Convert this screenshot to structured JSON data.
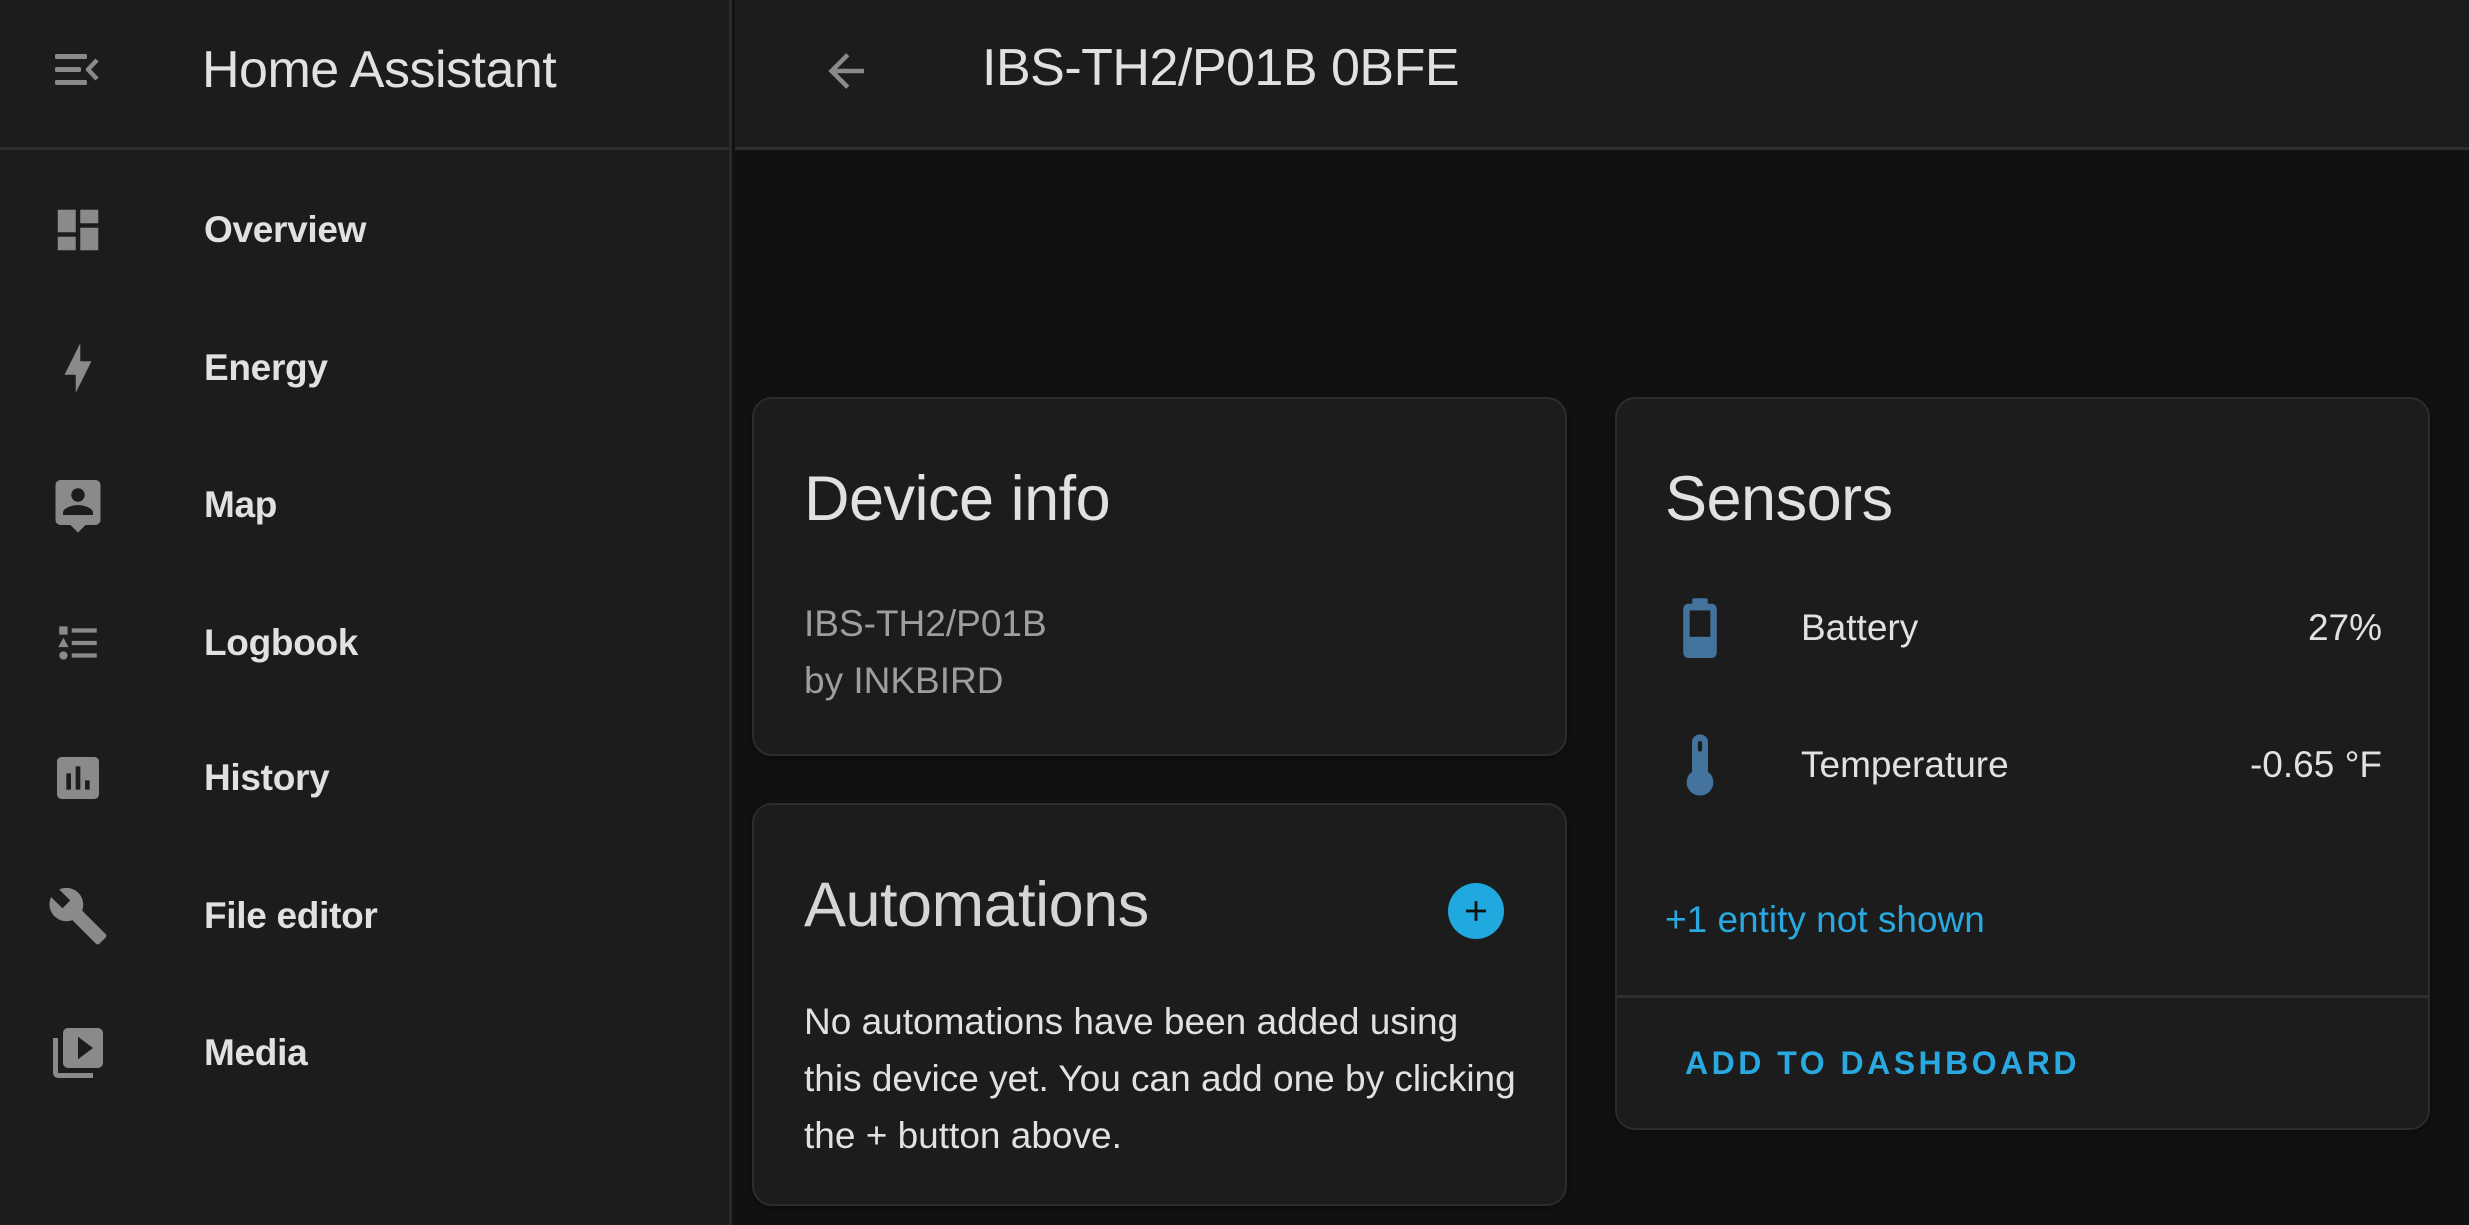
{
  "sidebar": {
    "title": "Home Assistant",
    "menu_icon": "menu-collapse-icon",
    "items": [
      {
        "label": "Overview",
        "icon": "view-dashboard-icon"
      },
      {
        "label": "Energy",
        "icon": "lightning-bolt-icon"
      },
      {
        "label": "Map",
        "icon": "account-location-icon"
      },
      {
        "label": "Logbook",
        "icon": "format-list-bulleted-type-icon"
      },
      {
        "label": "History",
        "icon": "chart-box-icon"
      },
      {
        "label": "File editor",
        "icon": "wrench-icon"
      },
      {
        "label": "Media",
        "icon": "play-box-multiple-icon"
      }
    ]
  },
  "header": {
    "back_icon": "arrow-left-icon",
    "title": "IBS-TH2/P01B 0BFE"
  },
  "device_info": {
    "title": "Device info",
    "model": "IBS-TH2/P01B",
    "manufacturer": "by INKBIRD"
  },
  "automations": {
    "title": "Automations",
    "add_icon": "plus-circle-icon",
    "empty_text": "No automations have been added using this device yet. You can add one by clicking the + button above."
  },
  "sensors": {
    "title": "Sensors",
    "entities": [
      {
        "name": "Battery",
        "value": "27%",
        "icon": "battery-icon",
        "level_percent": 27
      },
      {
        "name": "Temperature",
        "value": "-0.65 °F",
        "icon": "thermometer-icon"
      }
    ],
    "hidden_entities_text": "+1 entity not shown",
    "add_to_dashboard_label": "ADD TO DASHBOARD"
  },
  "colors": {
    "accent": "#29a9e0",
    "fab": "#1fa9df",
    "entity_icon": "#44739e",
    "sidebar_icon": "#8a8a8a",
    "sidebar_bg": "#1c1c1c",
    "page_bg": "#111111",
    "card_bg": "#1c1c1c",
    "secondary_text": "#9e9e9e"
  }
}
